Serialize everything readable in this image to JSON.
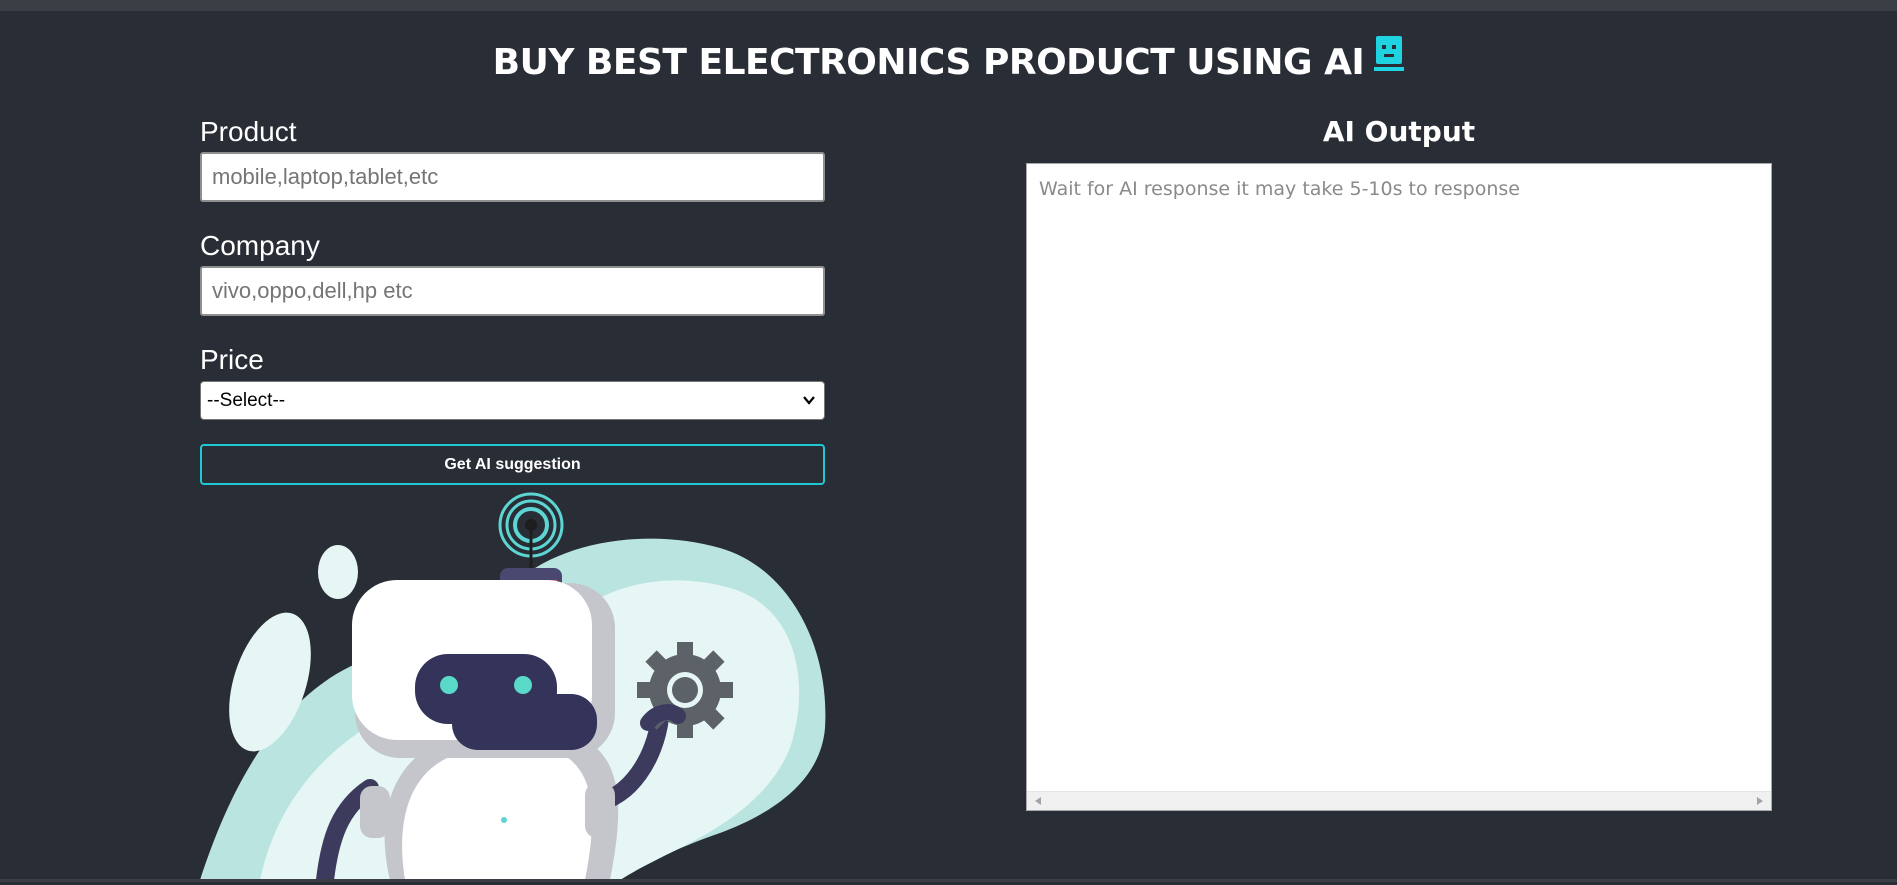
{
  "header": {
    "title": "BUY BEST ELECTRONICS PRODUCT USING AI",
    "icon": "robot-face-icon",
    "icon_color": "#1fd4e0"
  },
  "form": {
    "product": {
      "label": "Product",
      "placeholder": "mobile,laptop,tablet,etc",
      "value": ""
    },
    "company": {
      "label": "Company",
      "placeholder": "vivo,oppo,dell,hp etc",
      "value": ""
    },
    "price": {
      "label": "Price",
      "selected": "--Select--"
    },
    "submit_label": "Get AI suggestion",
    "accent_color": "#22c7d4"
  },
  "output": {
    "heading": "AI Output",
    "placeholder": "Wait for AI response it may take 5-10s to response"
  },
  "colors": {
    "background": "#292d35",
    "text": "#ffffff"
  }
}
